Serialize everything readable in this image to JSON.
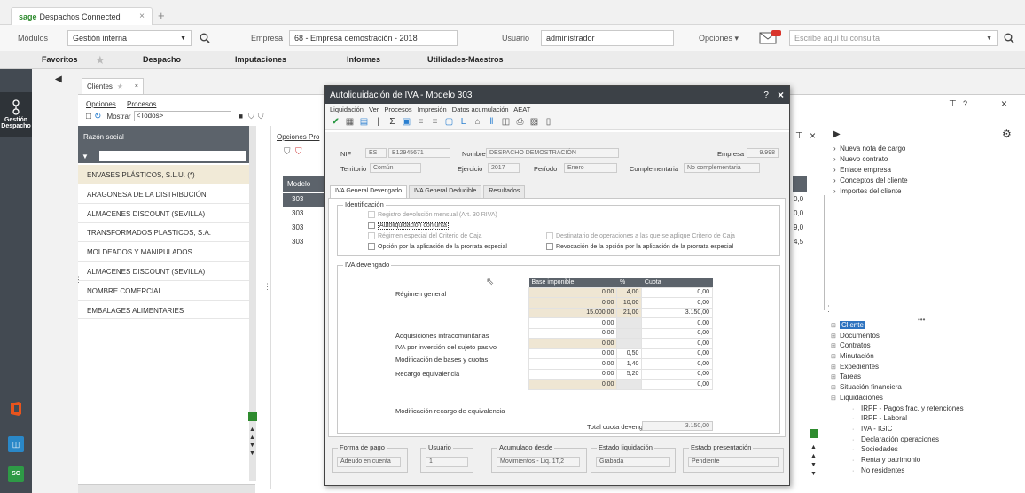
{
  "browser": {
    "brand": "sage",
    "tab_title": "Despachos Connected",
    "close": "×",
    "new_tab": "+"
  },
  "appbar": {
    "modulos_label": "Módulos",
    "modulo_value": "Gestión interna",
    "empresa_label": "Empresa",
    "empresa_value": "68 - Empresa demostración - 2018",
    "usuario_label": "Usuario",
    "usuario_value": "administrador",
    "opciones_label": "Opciones ▾",
    "search_placeholder": "Escribe aquí tu consulta"
  },
  "menubar": {
    "favoritos": "Favoritos",
    "items": [
      "Despacho",
      "Imputaciones",
      "Informes",
      "Utilidades-Maestros"
    ]
  },
  "rail": {
    "gestion_line1": "Gestión",
    "gestion_line2": "Despacho"
  },
  "clientes": {
    "tab_label": "Clientes",
    "menu": [
      "Opciones",
      "Procesos"
    ],
    "mostrar_label": "Mostrar",
    "mostrar_value": "<Todos>",
    "header": "Razón social",
    "rows": [
      "ENVASES PLÁSTICOS, S.L.U. (*)",
      "ARAGONESA DE LA DISTRIBUCIÓN",
      "ALMACENES DISCOUNT (SEVILLA)",
      "TRANSFORMADOS PLASTICOS, S.A.",
      "MOLDEADOS Y MANIPULADOS",
      "ALMACENES DISCOUNT (SEVILLA)",
      "NOMBRE COMERCIAL",
      "EMBALAGES ALIMENTARIES"
    ]
  },
  "mid": {
    "opciones": "Opciones Pro",
    "modelo_header": "Modelo",
    "modelo_rows": [
      "303",
      "303",
      "303",
      "303"
    ],
    "right_frag": [
      "0,0",
      "0,0",
      "9,0",
      "4,5"
    ]
  },
  "right": {
    "actions": [
      "Nueva nota de cargo",
      "Nuevo contrato",
      "Enlace empresa",
      "Conceptos del cliente",
      "Importes del cliente"
    ],
    "dots": "•••",
    "tree": [
      {
        "label": "Cliente",
        "level": 0,
        "selected": true
      },
      {
        "label": "Documentos",
        "level": 0
      },
      {
        "label": "Contratos",
        "level": 0
      },
      {
        "label": "Minutación",
        "level": 0
      },
      {
        "label": "Expedientes",
        "level": 0
      },
      {
        "label": "Tareas",
        "level": 0
      },
      {
        "label": "Situación financiera",
        "level": 0
      },
      {
        "label": "Liquidaciones",
        "level": 0,
        "open": true
      },
      {
        "label": "IRPF - Pagos frac. y retenciones",
        "level": 1
      },
      {
        "label": "IRPF - Laboral",
        "level": 1
      },
      {
        "label": "IVA - IGIC",
        "level": 1
      },
      {
        "label": "Declaración operaciones",
        "level": 1
      },
      {
        "label": "Sociedades",
        "level": 1
      },
      {
        "label": "Renta y patrimonio",
        "level": 1
      },
      {
        "label": "No residentes",
        "level": 1
      }
    ]
  },
  "modal": {
    "title": "Autoliquidación de IVA - Modelo 303",
    "help": "?",
    "close": "×",
    "menu": [
      "Liquidación",
      "Ver",
      "Procesos",
      "Impresión",
      "Datos acumulación",
      "AEAT"
    ],
    "nif_label": "NIF",
    "nif_country": "ES",
    "nif_value": "B12945671",
    "nombre_label": "Nombre",
    "nombre_value": "DESPACHO DEMOSTRACIÓN",
    "empresa_label": "Empresa",
    "empresa_value": "9.998",
    "territorio_label": "Territorio",
    "territorio_value": "Común",
    "ejercicio_label": "Ejercicio",
    "ejercicio_value": "2017",
    "periodo_label": "Período",
    "periodo_value": "Enero",
    "complementaria_label": "Complementaria",
    "complementaria_value": "No complementaria",
    "tabs": [
      "IVA General Devengado",
      "IVA General Deducible",
      "Resultados"
    ],
    "identificacion_title": "Identificación",
    "checks_left": [
      "Registro devolución mensual (Art. 30 RIVA)",
      "Autoliquidación conjunta",
      "Régimen especial del Criterio de Caja",
      "Opción por la aplicación de la prorrata especial"
    ],
    "checks_right": [
      "Destinatario de operaciones a las que se aplique Criterio de Caja",
      "Revocación de la opción por la aplicación de la prorrata especial"
    ],
    "iva_title": "IVA devengado",
    "col_base": "Base imponible",
    "col_pct": "%",
    "col_cuota": "Cuota",
    "row_labels": {
      "regimen": "Régimen general",
      "adquisiciones": "Adquisiciones intracomunitarias",
      "inversion": "IVA por inversión del sujeto pasivo",
      "modificacion": "Modificación de bases y cuotas",
      "recargo": "Recargo equivalencia",
      "mod_recargo": "Modificación recargo de equivalencia"
    },
    "rows": [
      {
        "base": "0,00",
        "pct": "4,00",
        "cuota": "0,00"
      },
      {
        "base": "0,00",
        "pct": "10,00",
        "cuota": "0,00"
      },
      {
        "base": "15.000,00",
        "pct": "21,00",
        "cuota": "3.150,00"
      },
      {
        "base": "0,00",
        "pct": "",
        "cuota": "0,00"
      },
      {
        "base": "0,00",
        "pct": "",
        "cuota": "0,00"
      },
      {
        "base": "0,00",
        "pct": "",
        "cuota": "0,00"
      },
      {
        "base": "0,00",
        "pct": "0,50",
        "cuota": "0,00"
      },
      {
        "base": "0,00",
        "pct": "1,40",
        "cuota": "0,00"
      },
      {
        "base": "0,00",
        "pct": "5,20",
        "cuota": "0,00"
      },
      {
        "base": "0,00",
        "pct": "",
        "cuota": "0,00"
      }
    ],
    "total_label": "Total cuota devengada",
    "total_value": "3.150,00",
    "footer": {
      "forma_pago_label": "Forma de pago",
      "forma_pago_value": "Adeudo en cuenta",
      "usuario_label": "Usuario",
      "usuario_value": "1",
      "acumulado_label": "Acumulado desde",
      "acumulado_value": "Movimientos - Liq. 1T,2",
      "estado_liq_label": "Estado liquidación",
      "estado_liq_value": "Grabada",
      "estado_pres_label": "Estado presentación",
      "estado_pres_value": "Pendiente"
    }
  },
  "colors": {
    "accent_green": "#2e8b2e",
    "rail": "#434a52",
    "header": "#5c636b",
    "modal_title": "#3c4147",
    "tan": "#efe6d3",
    "tree_selected": "#2f74c0"
  }
}
